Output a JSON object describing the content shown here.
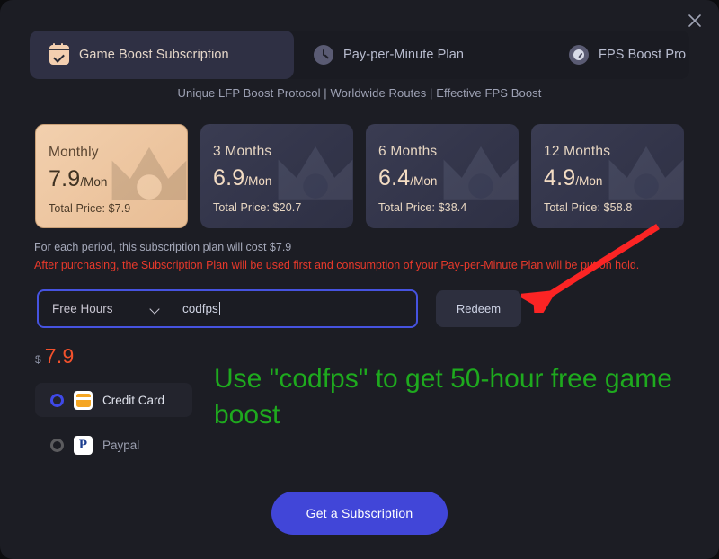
{
  "window": {
    "close_icon": "close-icon",
    "background": "#1c1d24"
  },
  "tabs": [
    {
      "label": "Game Boost Subscription",
      "icon": "calendar-check-icon",
      "active": true
    },
    {
      "label": "Pay-per-Minute Plan",
      "icon": "clock-icon",
      "active": false
    },
    {
      "label": "FPS Boost Pro",
      "icon": "gauge-icon",
      "active": false
    }
  ],
  "tagline": "Unique LFP Boost Protocol | Worldwide Routes | Effective FPS Boost",
  "plans": [
    {
      "title": "Monthly",
      "price": "7.9",
      "unit": "/Mon",
      "total": "Total Price: $7.9",
      "selected": true
    },
    {
      "title": "3 Months",
      "price": "6.9",
      "unit": "/Mon",
      "total": "Total Price: $20.7",
      "selected": false
    },
    {
      "title": "6 Months",
      "price": "6.4",
      "unit": "/Mon",
      "total": "Total Price: $38.4",
      "selected": false
    },
    {
      "title": "12 Months",
      "price": "4.9",
      "unit": "/Mon",
      "total": "Total Price: $58.8",
      "selected": false
    }
  ],
  "info": {
    "period_cost": "For each period, this subscription plan will cost $7.9",
    "warning": "After purchasing, the Subscription Plan will be used first and consumption of your Pay-per-Minute Plan will be put on hold.",
    "warning_color": "#e8392b"
  },
  "redeem": {
    "select_value": "Free Hours",
    "chevron_icon": "chevron-down-icon",
    "code_value": "codfps",
    "code_placeholder": "",
    "button_label": "Redeem",
    "focus_border_color": "#4653e0"
  },
  "total": {
    "currency": "$",
    "amount": "7.9",
    "amount_color": "#f2512c"
  },
  "payment_methods": [
    {
      "label": "Credit Card",
      "icon": "credit-card-icon",
      "selected": true
    },
    {
      "label": "Paypal",
      "icon": "paypal-icon",
      "selected": false
    }
  ],
  "cta": {
    "label": "Get a Subscription",
    "color": "#4146d8"
  },
  "annotations": {
    "green_text": "Use \"codfps\" to get 50-hour free game boost",
    "green_color": "#1eaa1e",
    "arrow_color": "#fc2424",
    "arrow_target": "redeem-button"
  }
}
